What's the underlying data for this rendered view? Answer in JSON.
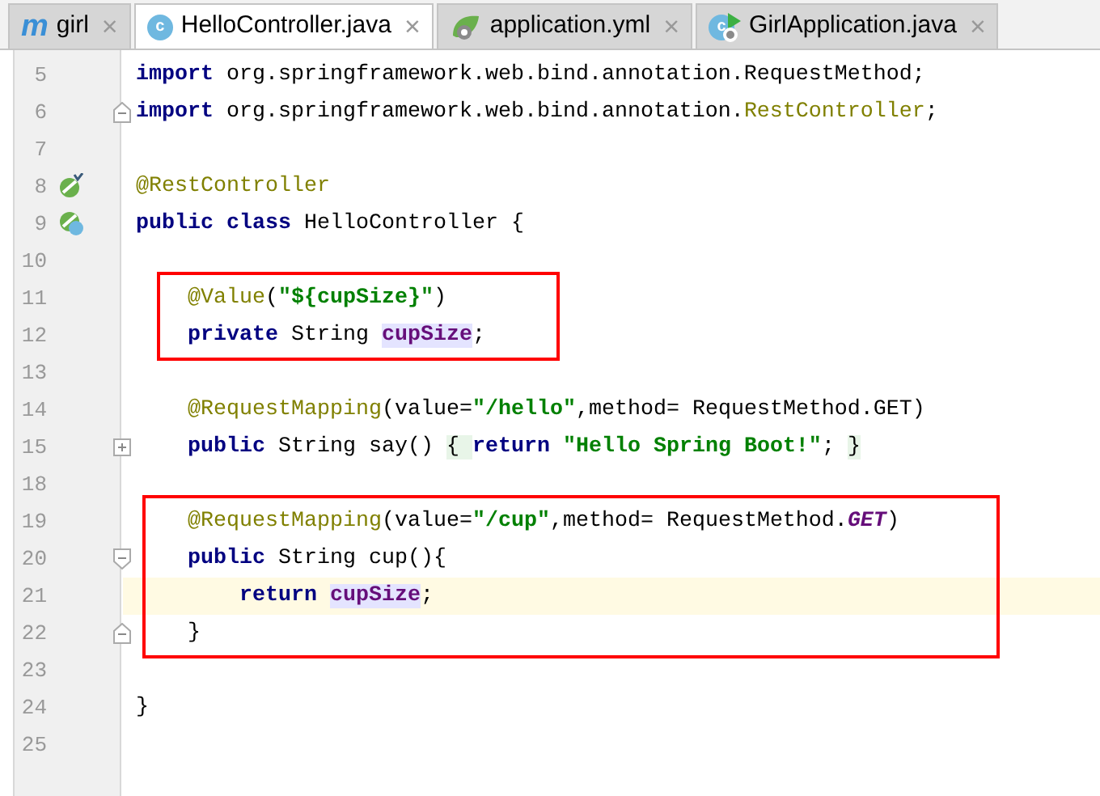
{
  "tabs": [
    {
      "label": "girl",
      "kind": "maven",
      "icon_letter": "m",
      "selected": false
    },
    {
      "label": "HelloController.java",
      "kind": "class",
      "icon_letter": "c",
      "selected": true
    },
    {
      "label": "application.yml",
      "kind": "config",
      "selected": false
    },
    {
      "label": "GirlApplication.java",
      "kind": "app",
      "icon_letter": "c",
      "selected": false
    }
  ],
  "close_glyph": "×",
  "lines": [
    {
      "number": "5",
      "current": false,
      "in_box": false,
      "tokens": [
        {
          "kind": "kw",
          "text": "import"
        },
        {
          "kind": "plain",
          "text": " org.springframework.web.bind.annotation.RequestMethod;"
        }
      ]
    },
    {
      "number": "6",
      "current": false,
      "in_box": false,
      "fold_end": true,
      "tokens": [
        {
          "kind": "kw",
          "text": "import"
        },
        {
          "kind": "plain",
          "text": " org.springframework.web.bind.annotation."
        },
        {
          "kind": "ann",
          "text": "RestController"
        },
        {
          "kind": "plain",
          "text": ";"
        }
      ]
    },
    {
      "number": "7",
      "current": false,
      "in_box": false
    },
    {
      "number": "8",
      "current": false,
      "in_box": false,
      "bean_marker": true,
      "tokens": [
        {
          "kind": "ann",
          "text": "@RestController"
        }
      ]
    },
    {
      "number": "9",
      "current": false,
      "in_box": false,
      "bean_class_marker": true,
      "tokens": [
        {
          "kind": "kw",
          "text": "public class"
        },
        {
          "kind": "plain",
          "text": " HelloController {"
        }
      ]
    },
    {
      "number": "10",
      "current": false,
      "in_box": false
    },
    {
      "number": "11",
      "current": false,
      "in_box": true,
      "tokens": [
        {
          "kind": "ann",
          "text": "    @Value"
        },
        {
          "kind": "plain",
          "text": "("
        },
        {
          "kind": "str",
          "text": "\"${cupSize}\""
        },
        {
          "kind": "plain",
          "text": ")"
        }
      ]
    },
    {
      "number": "12",
      "current": false,
      "in_box": true,
      "tokens": [
        {
          "kind": "kw",
          "text": "    private"
        },
        {
          "kind": "plain",
          "text": " String "
        },
        {
          "kind": "field",
          "text": "cupSize"
        },
        {
          "kind": "plain",
          "text": ";"
        }
      ]
    },
    {
      "number": "13",
      "current": false,
      "in_box": false
    },
    {
      "number": "14",
      "current": false,
      "in_box": false,
      "tokens": [
        {
          "kind": "ann",
          "text": "    @RequestMapping"
        },
        {
          "kind": "plain",
          "text": "(value="
        },
        {
          "kind": "str",
          "text": "\"/hello\""
        },
        {
          "kind": "plain",
          "text": ",method= RequestMethod.GET)"
        }
      ]
    },
    {
      "number": "15",
      "current": false,
      "in_box": false,
      "collapsed": true,
      "tokens": [
        {
          "kind": "kw",
          "text": "    public"
        },
        {
          "kind": "plain",
          "text": " String say() "
        },
        {
          "kind": "folded",
          "text": "{ "
        },
        {
          "kind": "kw",
          "text": "return "
        },
        {
          "kind": "str",
          "text": "\"Hello Spring Boot!\""
        },
        {
          "kind": "plain",
          "text": "; "
        },
        {
          "kind": "folded",
          "text": "}"
        }
      ]
    },
    {
      "number": "18",
      "current": false,
      "in_box": false
    },
    {
      "number": "19",
      "current": false,
      "in_box": true,
      "tokens": [
        {
          "kind": "ann",
          "text": "    @RequestMapping"
        },
        {
          "kind": "plain",
          "text": "(value="
        },
        {
          "kind": "str",
          "text": "\"/cup\""
        },
        {
          "kind": "plain",
          "text": ",method= RequestMethod."
        },
        {
          "kind": "const",
          "text": "GET"
        },
        {
          "kind": "plain",
          "text": ")"
        }
      ]
    },
    {
      "number": "20",
      "current": false,
      "in_box": true,
      "fold_start": true,
      "tokens": [
        {
          "kind": "kw",
          "text": "    public"
        },
        {
          "kind": "plain",
          "text": " String cup(){"
        }
      ]
    },
    {
      "number": "21",
      "current": true,
      "in_box": true,
      "tokens": [
        {
          "kind": "kw",
          "text": "        return "
        },
        {
          "kind": "field",
          "text": "cupSize"
        },
        {
          "kind": "plain",
          "text": ";"
        }
      ]
    },
    {
      "number": "22",
      "current": false,
      "in_box": true,
      "fold_end": true,
      "tokens": [
        {
          "kind": "plain",
          "text": "    }"
        }
      ]
    },
    {
      "number": "23",
      "current": false,
      "in_box": false
    },
    {
      "number": "24",
      "current": false,
      "in_box": false,
      "tokens": [
        {
          "kind": "plain",
          "text": "}"
        }
      ]
    },
    {
      "number": "25",
      "current": false,
      "in_box": false
    }
  ]
}
